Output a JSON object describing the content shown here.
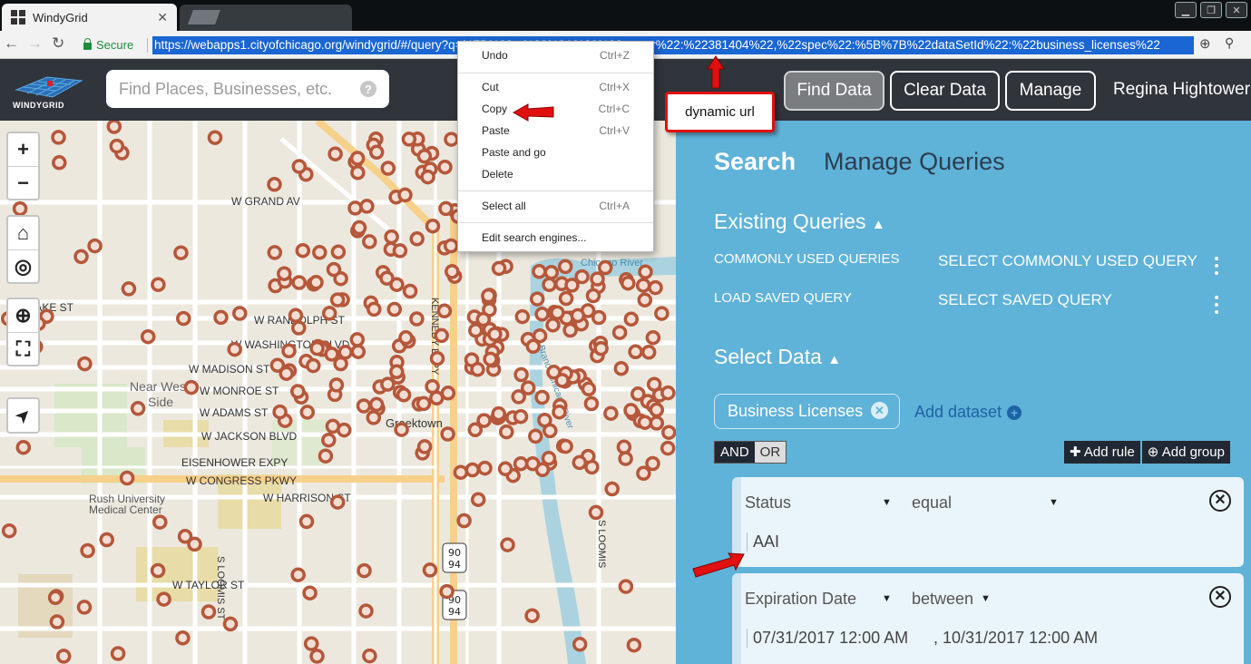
{
  "browser": {
    "tab_title": "WindyGrid",
    "tab_close": "✕",
    "secure_label": "Secure",
    "url": "https://webapps1.cityofchicago.org/windygrid/#/query?q=%7B%22...%22%3A%22%22owner%22:%22381404%22,%22spec%22:%5B%7B%22dataSetId%22:%22business_licenses%22"
  },
  "header": {
    "logo_text": "WINDYGRID",
    "search_placeholder": "Find Places, Businesses, etc.",
    "help_glyph": "?",
    "find_data": "Find Data",
    "clear_data": "Clear Data",
    "manage": "Manage",
    "user_name": "Regina Hightower"
  },
  "map": {
    "controls": {
      "zoom_in": "+",
      "zoom_out": "−",
      "home": "⌂",
      "locate": "◎",
      "zoom_box": "⊕",
      "fullscreen": "⛶",
      "navigate": "➤"
    },
    "labels": [
      "W GRAND AV",
      "W LAKE ST",
      "W RANDOLPH ST",
      "W WASHINGTON BLVD",
      "W MADISON ST",
      "W MONROE ST",
      "Near West Side",
      "W ADAMS ST",
      "W JACKSON BLVD",
      "EISENHOWER EXPY",
      "W CONGRESS PKWY",
      "W HARRISON ST",
      "Rush University Medical Center",
      "S LOOMIS ST",
      "W TAYLOR ST",
      "KENNEDY EXPY",
      "Greektown",
      "Chicago River",
      "S Branch Chicago River",
      "90",
      "94",
      "S LOOMIS"
    ],
    "marker_color": "#b5573a"
  },
  "panel": {
    "tab_search": "Search",
    "tab_manage": "Manage Queries",
    "existing_queries": "Existing Queries",
    "commonly_used_label": "COMMONLY USED QUERIES",
    "commonly_used_select": "SELECT COMMONLY USED QUERY",
    "load_saved_label": "LOAD SAVED QUERY",
    "load_saved_select": "SELECT SAVED QUERY",
    "select_data": "Select Data",
    "dataset_chip": "Business Licenses",
    "add_dataset": "Add dataset",
    "and": "AND",
    "or": "OR",
    "add_rule": "Add rule",
    "add_group": "Add group",
    "rules": [
      {
        "field": "Status",
        "operator": "equal",
        "value": "AAI"
      },
      {
        "field": "Expiration Date",
        "operator": "between",
        "value_from": "07/31/2017 12:00 AM",
        "value_to": "10/31/2017 12:00 AM"
      }
    ]
  },
  "context_menu": {
    "items": [
      {
        "label": "Undo",
        "shortcut": "Ctrl+Z"
      },
      {
        "label": "Cut",
        "shortcut": "Ctrl+X"
      },
      {
        "label": "Copy",
        "shortcut": "Ctrl+C"
      },
      {
        "label": "Paste",
        "shortcut": "Ctrl+V"
      },
      {
        "label": "Paste and go",
        "shortcut": ""
      },
      {
        "label": "Delete",
        "shortcut": ""
      },
      {
        "label": "Select all",
        "shortcut": "Ctrl+A"
      },
      {
        "label": "Edit search engines...",
        "shortcut": ""
      }
    ]
  },
  "annotation": {
    "callout_text": "dynamic url",
    "arrow_color": "#e01010"
  }
}
